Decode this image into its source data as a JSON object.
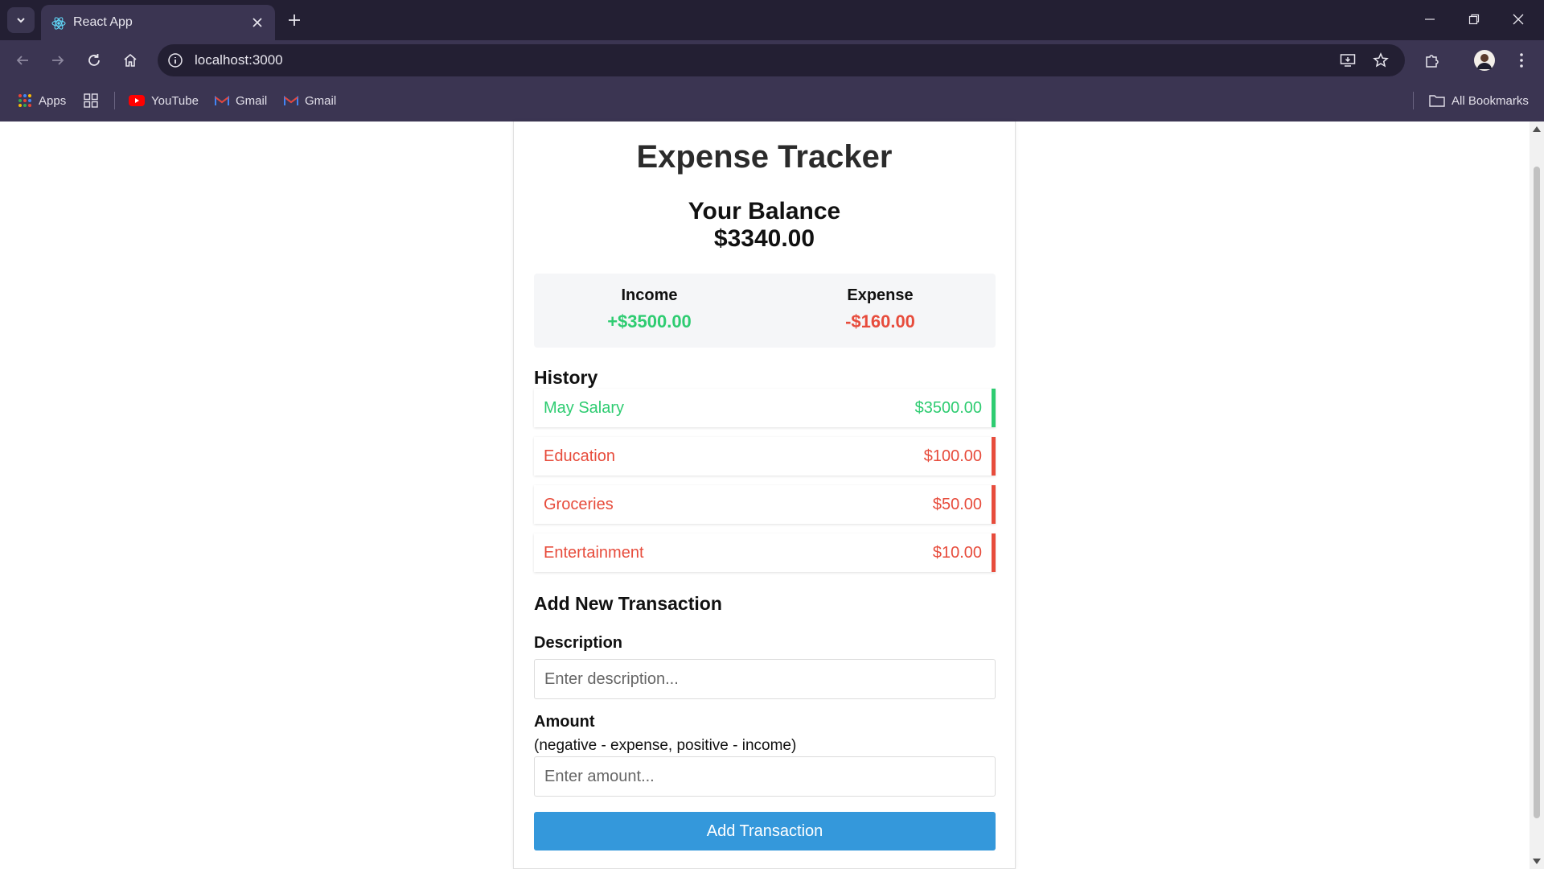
{
  "browser": {
    "tab_title": "React App",
    "url": "localhost:3000",
    "bookmarks": {
      "apps": "Apps",
      "youtube": "YouTube",
      "gmail_1": "Gmail",
      "gmail_2": "Gmail",
      "all_bookmarks": "All Bookmarks"
    }
  },
  "app": {
    "title": "Expense Tracker",
    "balance_label": "Your Balance",
    "balance_value": "$3340.00",
    "summary": {
      "income_label": "Income",
      "income_value": "+$3500.00",
      "expense_label": "Expense",
      "expense_value": "-$160.00"
    },
    "history_title": "History",
    "history": [
      {
        "description": "May Salary",
        "amount": "$3500.00",
        "type": "income"
      },
      {
        "description": "Education",
        "amount": "$100.00",
        "type": "expense"
      },
      {
        "description": "Groceries",
        "amount": "$50.00",
        "type": "expense"
      },
      {
        "description": "Entertainment",
        "amount": "$10.00",
        "type": "expense"
      }
    ],
    "form": {
      "title": "Add New Transaction",
      "description_label": "Description",
      "description_placeholder": "Enter description...",
      "amount_label": "Amount",
      "amount_hint": "(negative - expense, positive - income)",
      "amount_placeholder": "Enter amount...",
      "submit_label": "Add Transaction"
    }
  },
  "colors": {
    "income": "#2ecc71",
    "expense": "#e74c3c",
    "button": "#3498db",
    "browser_frame": "#231f33",
    "browser_toolbar": "#3b3552"
  }
}
